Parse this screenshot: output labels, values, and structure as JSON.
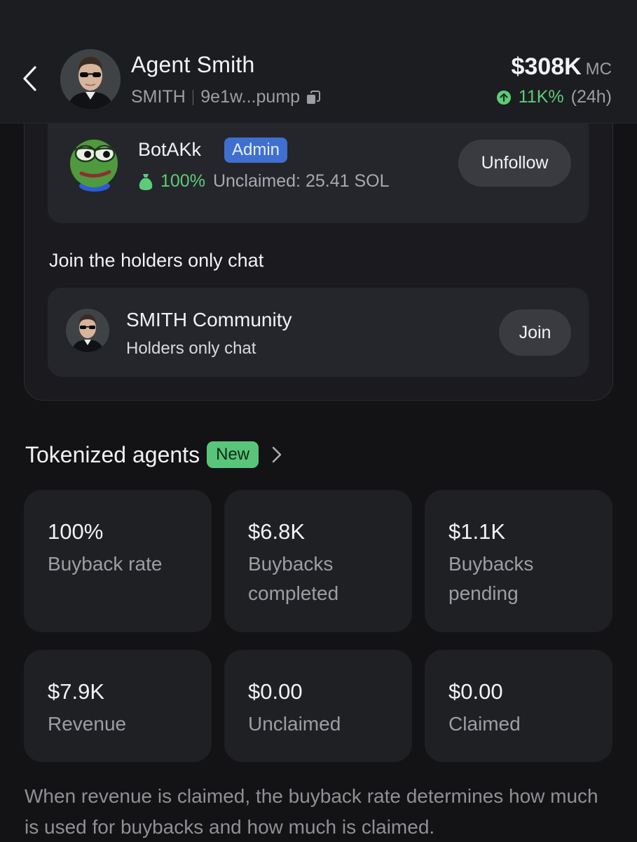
{
  "header": {
    "title": "Agent Smith",
    "ticker": "SMITH",
    "address": "9e1w...pump",
    "market_cap": "$308K",
    "market_cap_unit": "MC",
    "change": "11K%",
    "change_period": "(24h)"
  },
  "owner": {
    "name": "BotAKk",
    "badge": "Admin",
    "percent": "100%",
    "unclaimed": "Unclaimed: 25.41 SOL",
    "button": "Unfollow"
  },
  "holders_chat": {
    "heading": "Join the holders only chat",
    "title": "SMITH Community",
    "subtitle": "Holders only chat",
    "button": "Join"
  },
  "tokenized": {
    "title": "Tokenized agents",
    "badge": "New",
    "stats": [
      {
        "value": "100%",
        "label": "Buyback rate"
      },
      {
        "value": "$6.8K",
        "label": "Buybacks completed"
      },
      {
        "value": "$1.1K",
        "label": "Buybacks pending"
      },
      {
        "value": "$7.9K",
        "label": "Revenue"
      },
      {
        "value": "$0.00",
        "label": "Unclaimed"
      },
      {
        "value": "$0.00",
        "label": "Claimed"
      }
    ],
    "footnote": "When revenue is claimed, the buyback rate determines how much is used for buybacks and how much is claimed."
  },
  "colors": {
    "positive": "#5ecb7a",
    "admin_badge": "#3f6fcf",
    "new_badge": "#59c57b",
    "background": "#131316"
  },
  "icons": [
    "back-chevron-icon",
    "copy-icon",
    "arrow-up-circle-icon",
    "money-bag-icon",
    "chevron-right-icon"
  ]
}
